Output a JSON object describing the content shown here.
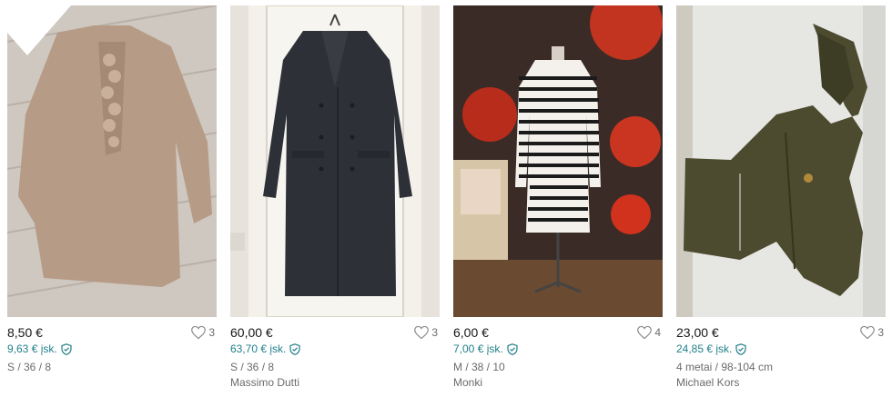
{
  "items": [
    {
      "price": "8,50 €",
      "buyer_price": "9,63 € įsk.",
      "favorites": "3",
      "details": "S / 36 / 8",
      "brand": "",
      "photo_subject": "beige ruffled blouse"
    },
    {
      "price": "60,00 €",
      "buyer_price": "63,70 € įsk.",
      "favorites": "3",
      "details": "S / 36 / 8",
      "brand": "Massimo Dutti",
      "photo_subject": "dark grey long coat"
    },
    {
      "price": "6,00 €",
      "buyer_price": "7,00 € įsk.",
      "favorites": "4",
      "details": "M / 38 / 10",
      "brand": "Monki",
      "photo_subject": "striped knit dress on mannequin"
    },
    {
      "price": "23,00 €",
      "buyer_price": "24,85 € įsk.",
      "favorites": "3",
      "details": "4 metai / 98-104 cm",
      "brand": "Michael Kors",
      "photo_subject": "olive hooded jacket"
    }
  ],
  "colors": {
    "buyer_price": "#1f7f88",
    "muted_text": "#6b6b6b"
  },
  "icons": {
    "favorite": "heart-outline-icon",
    "buyer_protection": "shield-check-icon"
  }
}
